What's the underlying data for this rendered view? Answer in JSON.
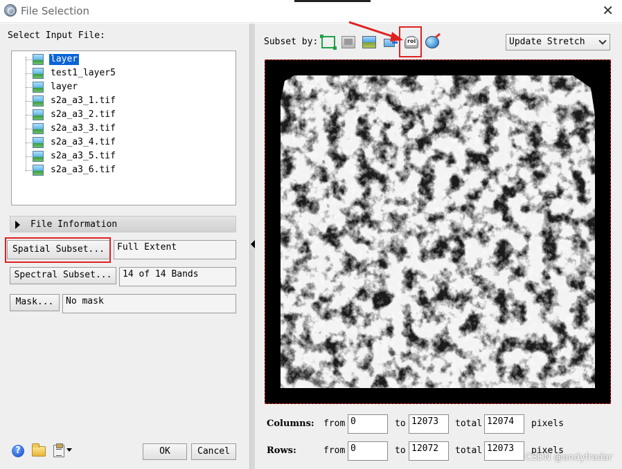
{
  "window": {
    "title": "File Selection",
    "close_glyph": "✕",
    "app_icon": "envi-globe-icon"
  },
  "left": {
    "select_label": "Select Input File:",
    "files": [
      {
        "name": "layer",
        "selected": true
      },
      {
        "name": "test1_layer5",
        "selected": false
      },
      {
        "name": "layer",
        "selected": false
      },
      {
        "name": "s2a_a3_1.tif",
        "selected": false
      },
      {
        "name": "s2a_a3_2.tif",
        "selected": false
      },
      {
        "name": "s2a_a3_3.tif",
        "selected": false
      },
      {
        "name": "s2a_a3_4.tif",
        "selected": false
      },
      {
        "name": "s2a_a3_5.tif",
        "selected": false
      },
      {
        "name": "s2a_a3_6.tif",
        "selected": false
      }
    ],
    "file_info_label": "File Information",
    "spatial_subset_label": "Spatial Subset...",
    "spatial_subset_value": "Full Extent",
    "spectral_subset_label": "Spectral Subset...",
    "spectral_subset_value": "14 of 14 Bands",
    "mask_label": "Mask...",
    "mask_value": "No mask",
    "help_glyph": "?",
    "ok_label": "OK",
    "cancel_label": "Cancel"
  },
  "right": {
    "subset_by_label": "Subset by:",
    "toolbar_icons": [
      "image-extent-icon",
      "display-icon",
      "image-icon",
      "file-transfer-icon",
      "roi-icon",
      "map-globe-icon"
    ],
    "stretch_dropdown": "Update Stretch",
    "columns_label": "Columns:",
    "rows_label": "Rows:",
    "from_label": "from",
    "to_label": "to",
    "total_label": "total",
    "pixels_label": "pixels",
    "columns": {
      "from": "0",
      "to": "12073",
      "total": "12074"
    },
    "rows": {
      "from": "0",
      "to": "12072",
      "total": "12073"
    }
  },
  "colors": {
    "highlight": "#e02020",
    "selection": "#0a64d6",
    "panel": "#efefef"
  },
  "watermark": "CSDN @andyfradar"
}
